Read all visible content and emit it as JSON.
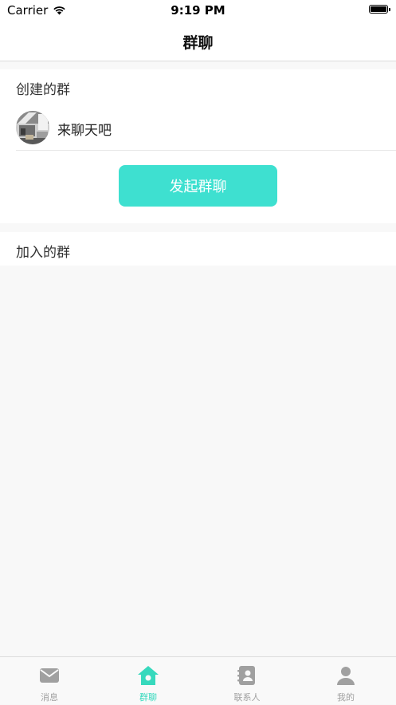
{
  "status_bar": {
    "carrier": "Carrier",
    "time": "9:19 PM"
  },
  "nav": {
    "title": "群聊"
  },
  "created_groups": {
    "title": "创建的群",
    "items": [
      {
        "name": "来聊天吧",
        "avatar": "group-photo"
      }
    ]
  },
  "start_group_button": {
    "label": "发起群聊"
  },
  "joined_groups": {
    "title": "加入的群",
    "items": []
  },
  "tabs": [
    {
      "label": "消息",
      "icon": "message-icon",
      "active": false
    },
    {
      "label": "群聊",
      "icon": "group-home-icon",
      "active": true
    },
    {
      "label": "联系人",
      "icon": "contacts-icon",
      "active": false
    },
    {
      "label": "我的",
      "icon": "profile-icon",
      "active": false
    }
  ],
  "colors": {
    "accent": "#3ee0d0",
    "tab_active": "#37d9bd",
    "tab_inactive": "#a0a0a0",
    "background": "#f8f8f8"
  }
}
